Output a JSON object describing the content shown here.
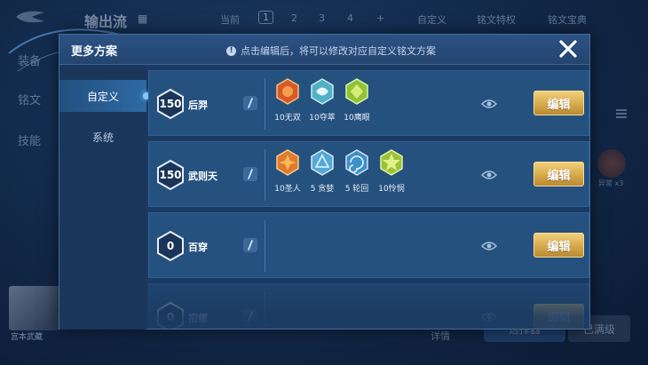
{
  "background": {
    "screen_title": "输出流",
    "top_tabs": [
      "当前",
      "1",
      "2",
      "3",
      "4",
      "+",
      "自定义",
      "铭文特权",
      "铭文宝典"
    ],
    "left_menu": [
      "装备",
      "铭文",
      "技能"
    ],
    "avatar_name": "宫本武藏",
    "bottom_buttons": [
      "选择器",
      "已满级"
    ],
    "bottom_text": "详情",
    "rune_label": "异常 x3"
  },
  "modal": {
    "title": "更多方案",
    "hint": "点击编辑后，将可以修改对应自定义铭文方案",
    "tabs": [
      {
        "label": "自定义",
        "active": true
      },
      {
        "label": "系统",
        "active": false
      }
    ],
    "edit_label": "编辑",
    "presets": [
      {
        "level": "150",
        "hero": "后羿",
        "runes": [
          {
            "label": "10无双",
            "color": "#d9582a"
          },
          {
            "label": "10夺萃",
            "color": "#4fb0c6"
          },
          {
            "label": "10鹰眼",
            "color": "#8fc43a"
          }
        ]
      },
      {
        "level": "150",
        "hero": "武则天",
        "runes": [
          {
            "label": "10圣人",
            "color": "#e07a2e"
          },
          {
            "label": "5 贪婪",
            "color": "#54a9d6"
          },
          {
            "label": "5 轮回",
            "color": "#3f8fc9"
          },
          {
            "label": "10怜悯",
            "color": "#9cc23b"
          }
        ]
      },
      {
        "level": "0",
        "hero": "百穿",
        "runes": []
      },
      {
        "level": "0",
        "hero": "招螺",
        "runes": []
      }
    ]
  }
}
